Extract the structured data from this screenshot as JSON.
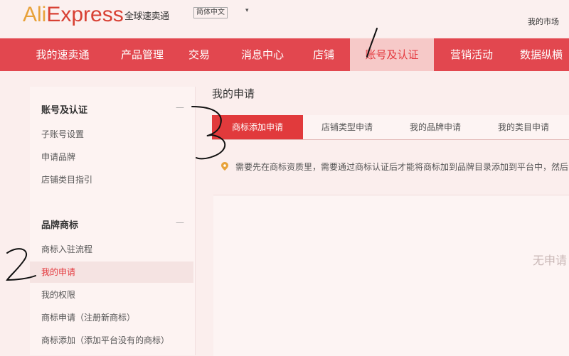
{
  "header": {
    "logo_part1": "Ali",
    "logo_part2": "Express",
    "logo_subtitle": "全球速卖通",
    "language": "简体中文",
    "language_caret": "▾",
    "top_right_link": "我的市场"
  },
  "nav": {
    "items": [
      "我的速卖通",
      "产品管理",
      "交易",
      "消息中心",
      "店铺",
      "账号及认证",
      "营销活动",
      "数据纵横"
    ],
    "active_index": 5
  },
  "sidebar": {
    "section1_title": "账号及认证",
    "section1_items": [
      "子账号设置",
      "申请品牌",
      "店铺类目指引"
    ],
    "section2_title": "品牌商标",
    "section2_items": [
      "商标入驻流程",
      "我的申请",
      "我的权限",
      "商标申请（注册新商标）",
      "商标添加（添加平台没有的商标）"
    ],
    "active_item": "我的申请",
    "collapse_symbol": "—"
  },
  "main": {
    "title": "我的申请",
    "tabs": [
      "商标添加申请",
      "店铺类型申请",
      "我的品牌申请",
      "我的类目申请"
    ],
    "active_tab": 0,
    "notice_text": "需要先在商标资质里，需要通过商标认证后才能将商标加到品牌目录添加到平台中，然后",
    "empty_text": "无申请"
  },
  "colors": {
    "nav_red": "#e2474f",
    "tab_red": "#e13a3c",
    "logo_orange": "#e8a23a",
    "logo_red": "#d84033"
  }
}
